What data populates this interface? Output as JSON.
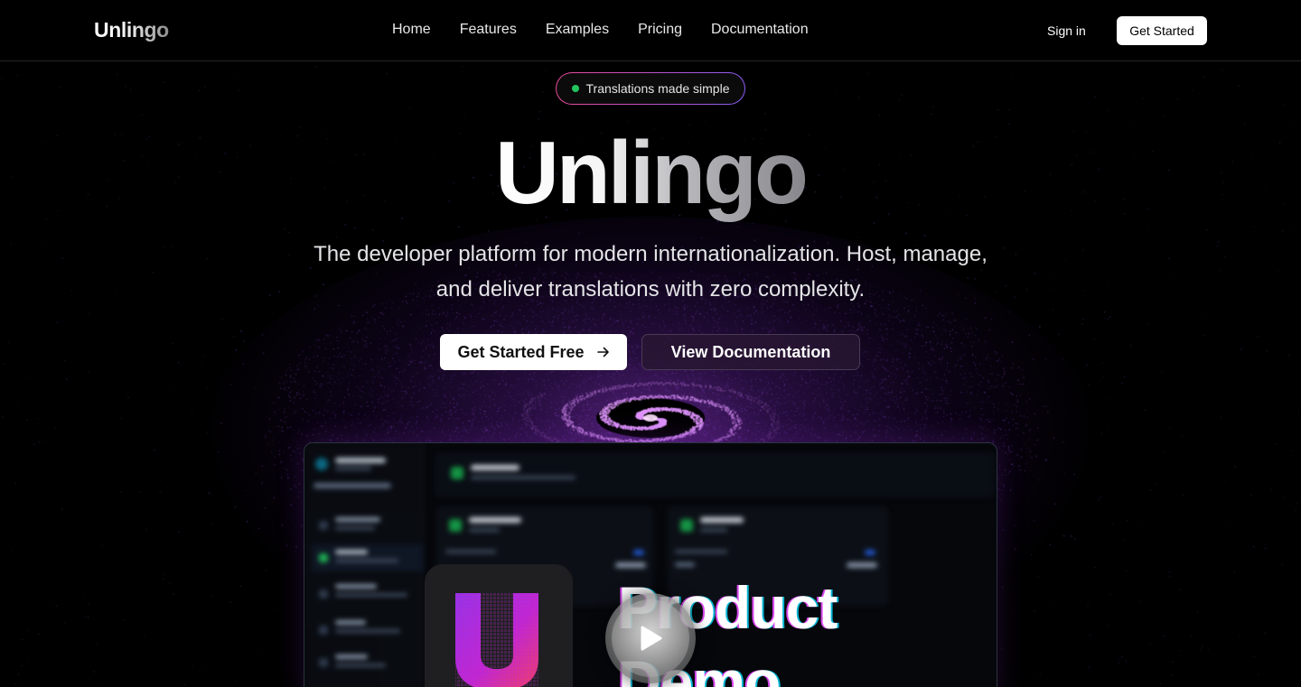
{
  "nav": {
    "brand": "Unlingo",
    "links": [
      "Home",
      "Features",
      "Examples",
      "Pricing",
      "Documentation"
    ],
    "sign_in": "Sign in",
    "get_started": "Get Started"
  },
  "hero": {
    "badge": "Translations made simple",
    "title": "Unlingo",
    "subtitle_line1": "The developer platform for modern internationalization. Host, manage,",
    "subtitle_line2": "and deliver translations with zero complexity.",
    "primary_cta": "Get Started Free",
    "primary_cta_icon": "arrow-right-icon",
    "secondary_cta": "View Documentation"
  },
  "video": {
    "title_line1": "Product",
    "title_line2": "Demo",
    "play_icon": "play-icon"
  },
  "colors": {
    "background": "#000000",
    "accent_purple": "#a855f7",
    "accent_pink": "#ec4899",
    "status_green": "#22c55e"
  }
}
